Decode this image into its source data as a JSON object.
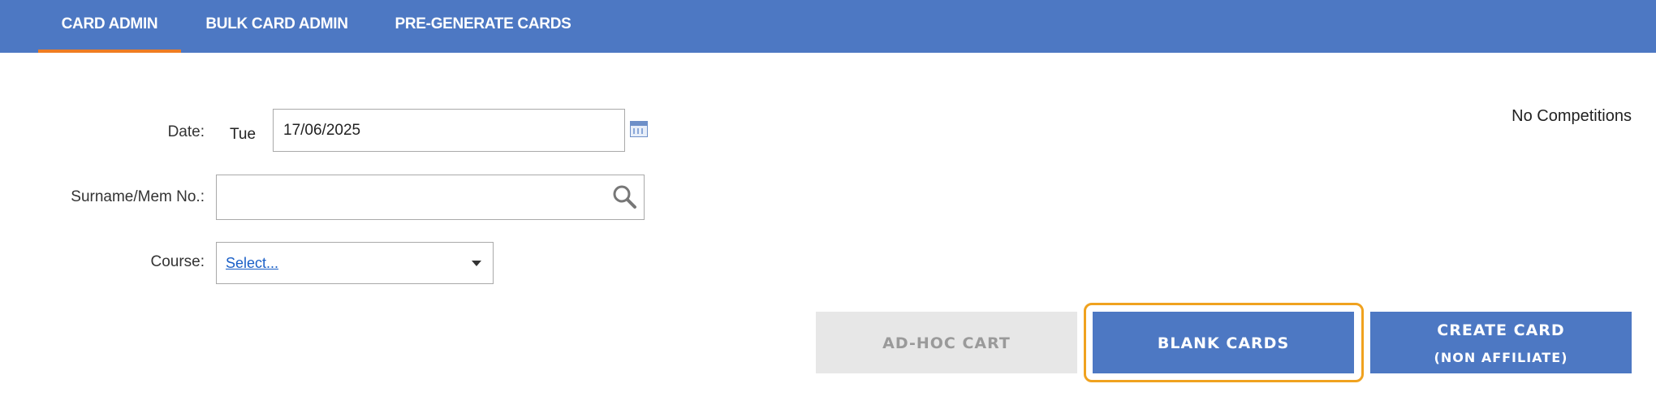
{
  "nav": {
    "tabs": [
      {
        "label": "CARD ADMIN",
        "active": true
      },
      {
        "label": "BULK CARD ADMIN",
        "active": false
      },
      {
        "label": "PRE-GENERATE CARDS",
        "active": false
      }
    ]
  },
  "form": {
    "date_label": "Date:",
    "day_of_week": "Tue",
    "date_value": "17/06/2025",
    "surname_label": "Surname/Mem No.:",
    "surname_value": "",
    "course_label": "Course:",
    "course_selected": "Select..."
  },
  "status": {
    "competitions": "No Competitions"
  },
  "buttons": {
    "adhoc_cart": "AD-HOC CART",
    "blank_cards": "BLANK CARDS",
    "create_card_line1": "CREATE CARD",
    "create_card_line2": "(NON AFFILIATE)"
  },
  "colors": {
    "nav_bg": "#4d78c3",
    "active_underline": "#ef7d22",
    "primary_button": "#4d78c3",
    "disabled_button": "#e7e7e7",
    "focus_ring": "#f0a21f",
    "link": "#1a5fc7"
  },
  "icons": {
    "calendar": "calendar-icon",
    "search": "search-icon",
    "dropdown": "chevron-down-icon"
  }
}
